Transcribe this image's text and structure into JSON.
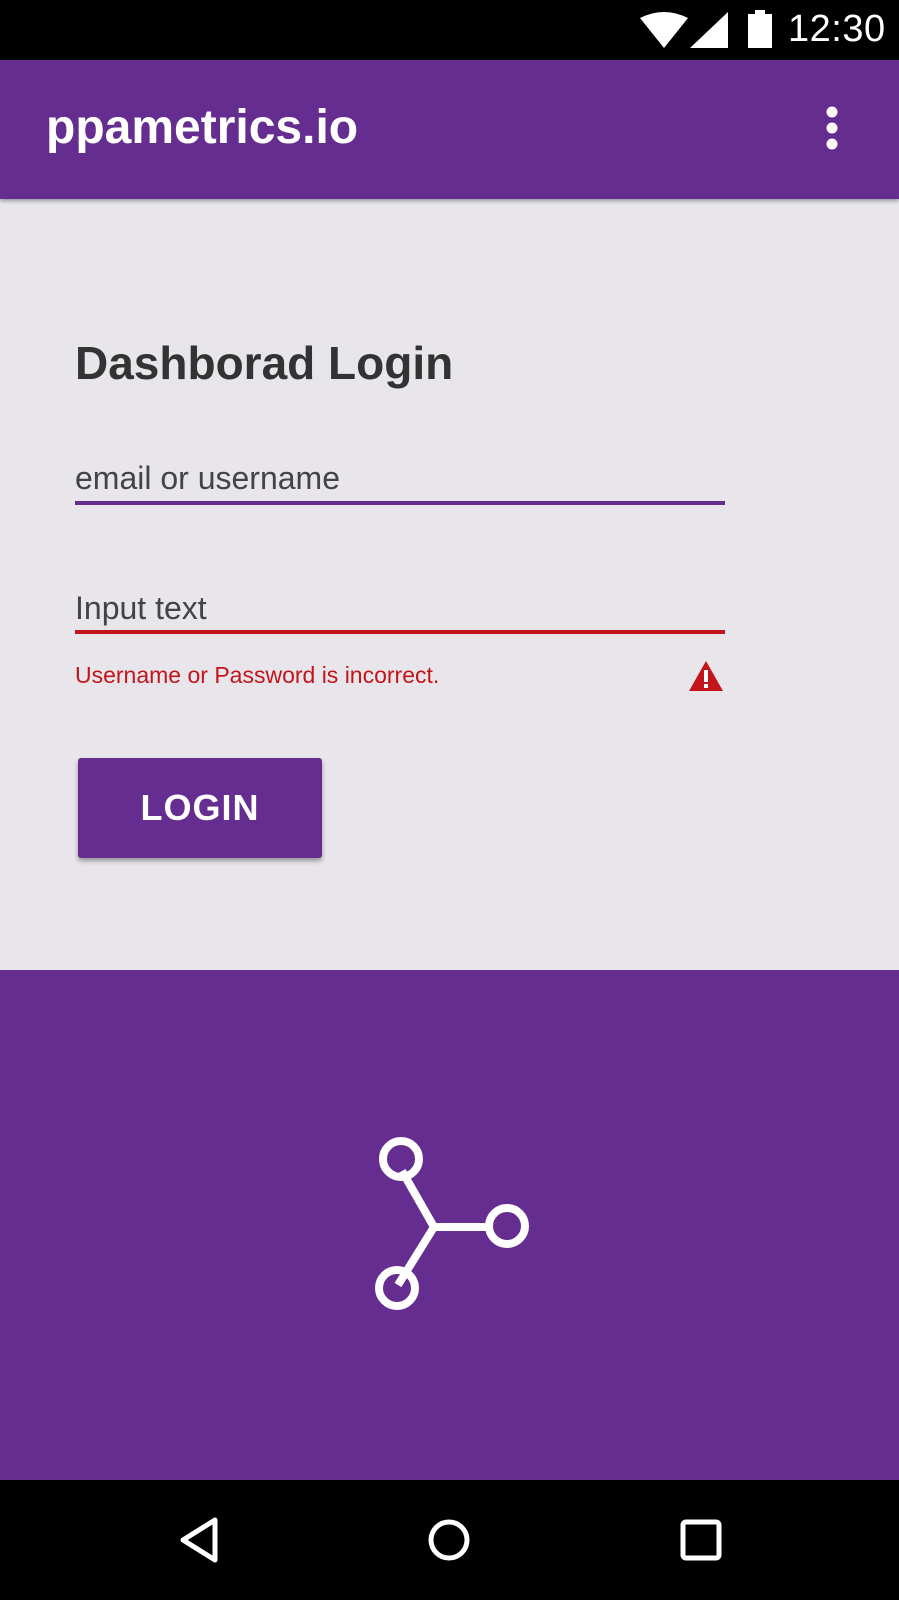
{
  "status_bar": {
    "time": "12:30",
    "icons": [
      "wifi-icon",
      "cell-signal-icon",
      "battery-icon"
    ]
  },
  "app_bar": {
    "title": "ppametrics.io",
    "menu_icon": "more-vert-icon"
  },
  "login": {
    "title": "Dashborad Login",
    "username": {
      "value": "",
      "placeholder": "email or username"
    },
    "password": {
      "value": "",
      "placeholder": "Input text"
    },
    "error_message": "Username or Password is incorrect.",
    "error_icon": "warning-icon",
    "button_label": "LOGIN"
  },
  "footer": {
    "icon": "share-icon"
  },
  "nav_bar": {
    "icons": [
      "back-icon",
      "home-icon",
      "recents-icon"
    ]
  },
  "colors": {
    "primary": "#662d91",
    "background": "#e8e6ea",
    "error": "#c4141b",
    "system_bar": "#000000"
  }
}
